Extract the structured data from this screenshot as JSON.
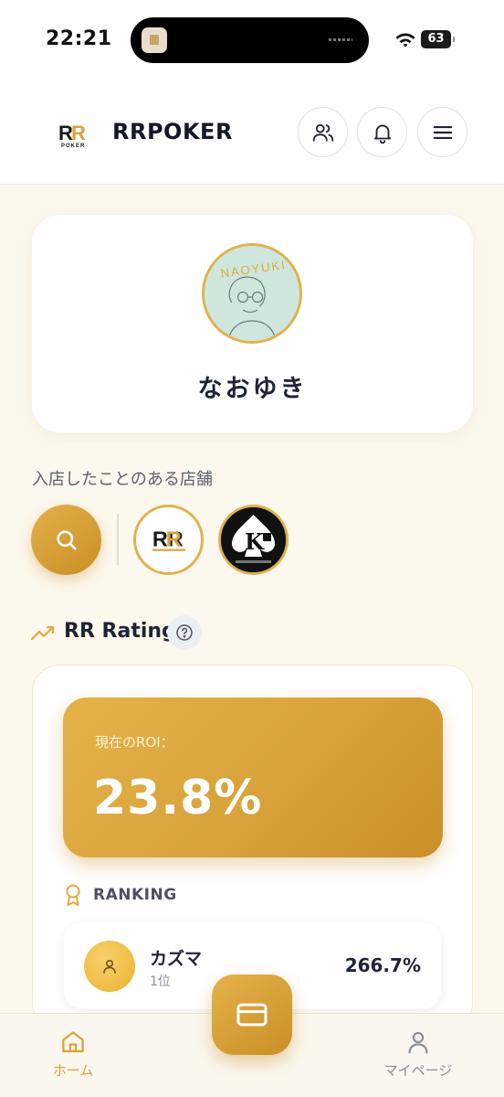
{
  "status_bar": {
    "time": "22:21",
    "battery": "63"
  },
  "header": {
    "app_name": "RRPOKER",
    "icons": [
      "friends-icon",
      "bell-icon",
      "menu-icon"
    ]
  },
  "profile": {
    "name": "なおゆき"
  },
  "visited_stores": {
    "label": "入店したことのある店舗",
    "stores": [
      "RR",
      "K"
    ]
  },
  "rating": {
    "title": "RR Rating",
    "roi_label": "現在のROI：",
    "roi_value": "23.8%",
    "ranking_label": "RANKING",
    "ranking": [
      {
        "name": "カズマ",
        "position": "1位",
        "roi": "266.7%"
      }
    ]
  },
  "bottom_nav": {
    "home": "ホーム",
    "mypage": "マイページ"
  },
  "colors": {
    "accent": "#d9a23a",
    "background": "#fdf8ee"
  }
}
